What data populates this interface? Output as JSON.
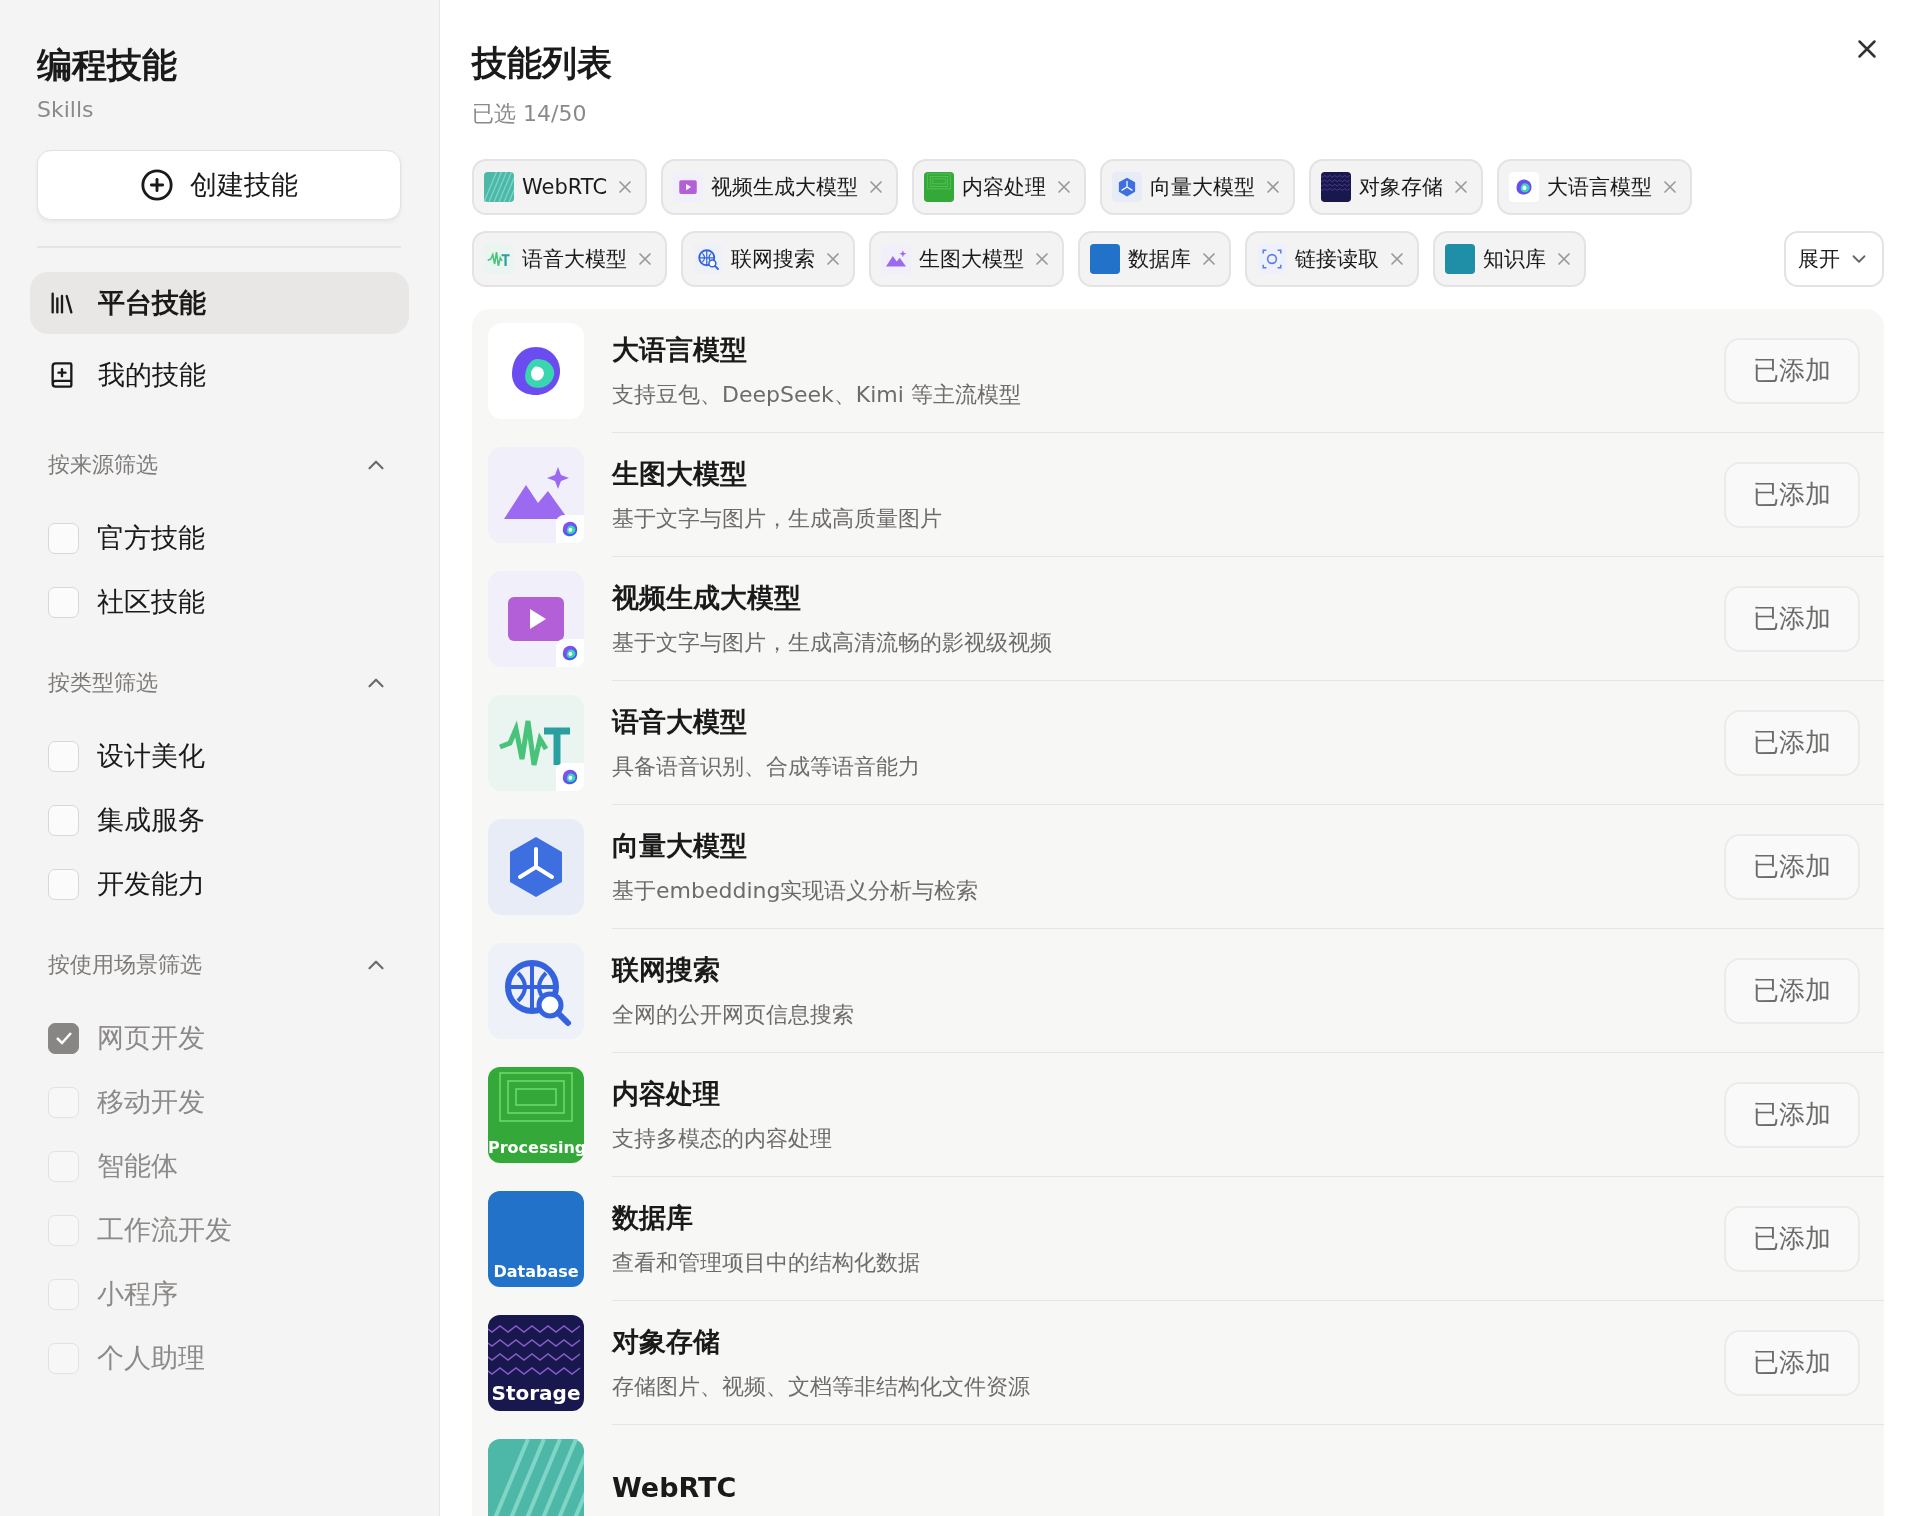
{
  "sidebar": {
    "title": "编程技能",
    "subtitle": "Skills",
    "create_button": "创建技能",
    "nav": [
      {
        "label": "平台技能",
        "kind": "library",
        "selected": true
      },
      {
        "label": "我的技能",
        "kind": "book",
        "selected": false
      }
    ],
    "filters": [
      {
        "title": "按来源筛选",
        "expanded": true,
        "options": [
          {
            "label": "官方技能",
            "checked": false,
            "disabled": false
          },
          {
            "label": "社区技能",
            "checked": false,
            "disabled": false
          }
        ]
      },
      {
        "title": "按类型筛选",
        "expanded": true,
        "options": [
          {
            "label": "设计美化",
            "checked": false,
            "disabled": false
          },
          {
            "label": "集成服务",
            "checked": false,
            "disabled": false
          },
          {
            "label": "开发能力",
            "checked": false,
            "disabled": false
          }
        ]
      },
      {
        "title": "按使用场景筛选",
        "expanded": true,
        "options": [
          {
            "label": "网页开发",
            "checked": true,
            "disabled": true
          },
          {
            "label": "移动开发",
            "checked": false,
            "disabled": true
          },
          {
            "label": "智能体",
            "checked": false,
            "disabled": true
          },
          {
            "label": "工作流开发",
            "checked": false,
            "disabled": true
          },
          {
            "label": "小程序",
            "checked": false,
            "disabled": true
          },
          {
            "label": "个人助理",
            "checked": false,
            "disabled": true
          }
        ]
      }
    ]
  },
  "main": {
    "title": "技能列表",
    "selected_count": "已选 14/50",
    "chips": [
      {
        "label": "WebRTC",
        "kind": "webrtc"
      },
      {
        "label": "视频生成大模型",
        "kind": "video"
      },
      {
        "label": "内容处理",
        "kind": "processing"
      },
      {
        "label": "向量大模型",
        "kind": "vector"
      },
      {
        "label": "对象存储",
        "kind": "storage"
      },
      {
        "label": "大语言模型",
        "kind": "llm"
      },
      {
        "label": "语音大模型",
        "kind": "audio"
      },
      {
        "label": "联网搜索",
        "kind": "search"
      },
      {
        "label": "生图大模型",
        "kind": "image"
      },
      {
        "label": "数据库",
        "kind": "database"
      },
      {
        "label": "链接读取",
        "kind": "link"
      },
      {
        "label": "知识库",
        "kind": "knowledge"
      }
    ],
    "expand_button": "展开",
    "skills": [
      {
        "name": "大语言模型",
        "description": "支持豆包、DeepSeek、Kimi 等主流模型",
        "kind": "llm",
        "badge": false,
        "button": "已添加"
      },
      {
        "name": "生图大模型",
        "description": "基于文字与图片，生成高质量图片",
        "kind": "image",
        "badge": true,
        "button": "已添加"
      },
      {
        "name": "视频生成大模型",
        "description": "基于文字与图片，生成高清流畅的影视级视频",
        "kind": "video",
        "badge": true,
        "button": "已添加"
      },
      {
        "name": "语音大模型",
        "description": "具备语音识别、合成等语音能力",
        "kind": "audio",
        "badge": true,
        "button": "已添加"
      },
      {
        "name": "向量大模型",
        "description": "基于embedding实现语义分析与检索",
        "kind": "vector",
        "badge": false,
        "button": "已添加"
      },
      {
        "name": "联网搜索",
        "description": "全网的公开网页信息搜索",
        "kind": "search",
        "badge": false,
        "button": "已添加"
      },
      {
        "name": "内容处理",
        "description": "支持多模态的内容处理",
        "kind": "processing",
        "icon_label": "Processing",
        "badge": false,
        "button": "已添加"
      },
      {
        "name": "数据库",
        "description": "查看和管理项目中的结构化数据",
        "kind": "database",
        "icon_label": "Database",
        "badge": false,
        "button": "已添加"
      },
      {
        "name": "对象存储",
        "description": "存储图片、视频、文档等非结构化文件资源",
        "kind": "storage",
        "icon_label": "Storage",
        "badge": false,
        "button": "已添加"
      },
      {
        "name": "WebRTC",
        "kind": "webrtc",
        "badge": false
      }
    ]
  }
}
